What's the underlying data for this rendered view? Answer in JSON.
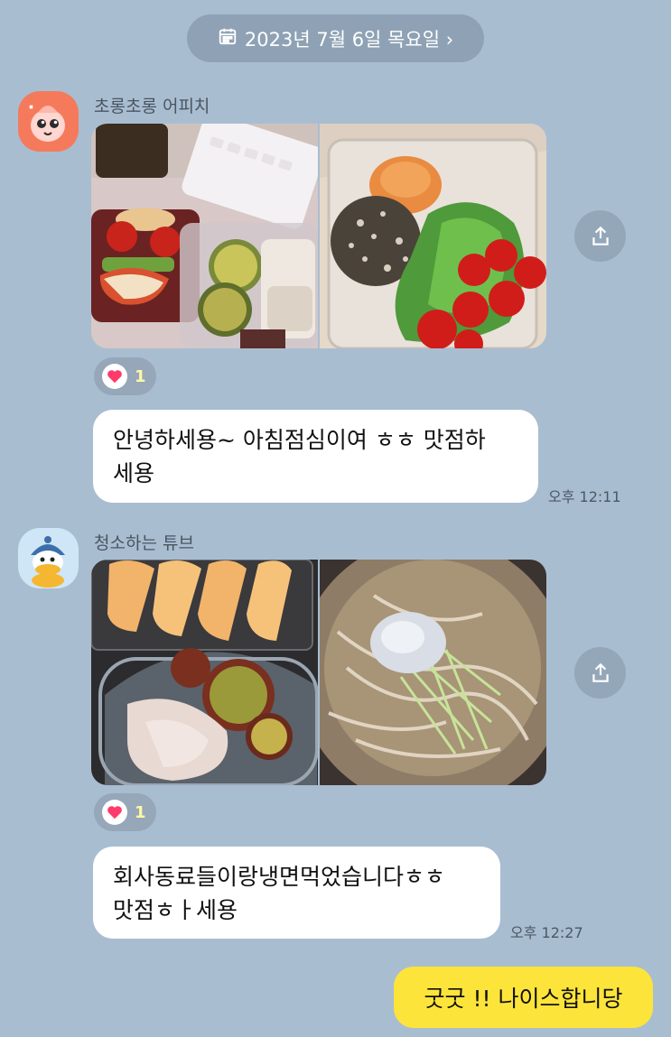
{
  "date_divider": {
    "label": "2023년 7월 6일 목요일 ›",
    "icon": "calendar-icon"
  },
  "messages": [
    {
      "sender": "초롱초롱 어피치",
      "photo_left": "lunch box with tomatoes, celery, apple, sweet potato and chicken",
      "photo_right": "container with grain patty, salad and cherry tomatoes",
      "reaction_count": "1",
      "text": "안녕하세용~ 아침점심이여 ㅎㅎ 맛점하\n세용",
      "time": "오후 12:11"
    },
    {
      "sender": "청소하는 튜브",
      "photo_left": "apple slices, sweet potato and chicken breast",
      "photo_right": "cold noodles with egg",
      "reaction_count": "1",
      "text": "회사동료들이랑냉면먹었습니다ㅎㅎ\n맛점ㅎㅏ세용",
      "time": "오후 12:27"
    }
  ],
  "my_message": {
    "text": "굿굿 !! 나이스합니당"
  },
  "colors": {
    "background": "#a9bdd1",
    "my_bubble": "#fde43a",
    "heart": "#ff3b6b",
    "reaction_count": "#fff7a6"
  }
}
